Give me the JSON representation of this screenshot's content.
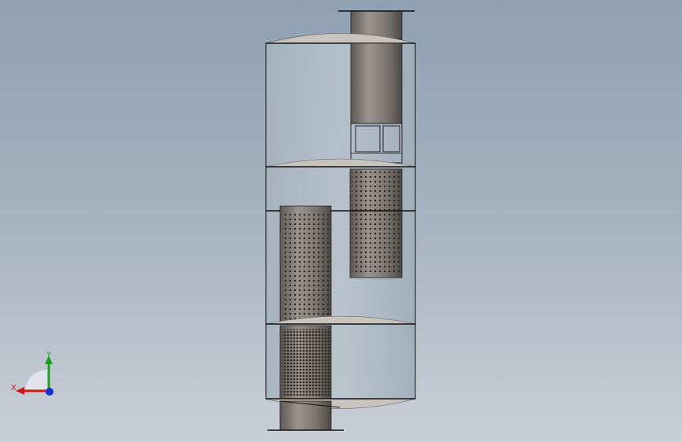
{
  "viewport": {
    "background_top": "#8fa0b3",
    "background_bottom": "#c9cfd6"
  },
  "model": {
    "shell_color": "#aebbc6",
    "outline_color": "#111111",
    "pipe_color": "#7a7470",
    "dome_color": "#c8c3bc",
    "perforation_color": "#2a2622"
  },
  "triad": {
    "x_label": "X",
    "y_label": "Y",
    "x_color": "#d01818",
    "y_color": "#1aa01a",
    "z_color": "#1830d0",
    "icon": "coordinate-triad-icon"
  }
}
